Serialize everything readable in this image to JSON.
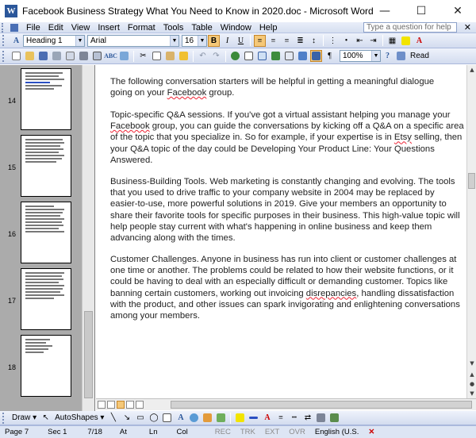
{
  "window": {
    "title": "Facebook Business Strategy What You Need to Know in 2020.doc - Microsoft Word",
    "minimize": "—",
    "maximize": "☐",
    "close": "✕"
  },
  "menu": {
    "items": [
      "File",
      "Edit",
      "View",
      "Insert",
      "Format",
      "Tools",
      "Table",
      "Window",
      "Help"
    ],
    "question_placeholder": "Type a question for help",
    "close_glyph": "✕"
  },
  "format_toolbar": {
    "style": "Heading 1",
    "font": "Arial",
    "size": "16",
    "bold": "B",
    "italic": "I",
    "underline": "U"
  },
  "standard_toolbar": {
    "zoom": "100%",
    "read_label": "Read"
  },
  "thumbnails": [
    {
      "page": "14"
    },
    {
      "page": "15"
    },
    {
      "page": "16"
    },
    {
      "page": "17"
    },
    {
      "page": "18"
    }
  ],
  "document": {
    "paragraphs": [
      {
        "lines": [
          [
            {
              "t": "The following conversation starters will be helpful in getting a meaningful dialogue"
            }
          ],
          [
            {
              "t": "going on your "
            },
            {
              "t": "Facebook",
              "sq": true
            },
            {
              "t": " group."
            }
          ]
        ]
      },
      {
        "lines": [
          [
            {
              "t": "Topic-specific Q&A sessions. If you've got a virtual assistant helping you manage your"
            }
          ],
          [
            {
              "t": "Facebook",
              "sq": true
            },
            {
              "t": " group, you can guide the conversations by kicking off a Q&A on a specific area"
            }
          ],
          [
            {
              "t": "of the topic that you specialize in. So for example, if your expertise is in "
            },
            {
              "t": "Etsy",
              "sq": true
            },
            {
              "t": " selling, then"
            }
          ],
          [
            {
              "t": "your Q&A topic of the day could be Developing Your Product Line: Your Questions"
            }
          ],
          [
            {
              "t": "Answered."
            }
          ]
        ]
      },
      {
        "lines": [
          [
            {
              "t": "Business-Building Tools. Web marketing is constantly changing and evolving. The tools"
            }
          ],
          [
            {
              "t": "that you used to drive traffic to your company website in 2004 may be replaced by"
            }
          ],
          [
            {
              "t": "easier-to-use, more powerful solutions in 2019. Give your members an opportunity to"
            }
          ],
          [
            {
              "t": "share their favorite tools for specific purposes in their business. This high-value topic will"
            }
          ],
          [
            {
              "t": "help people stay current with what's happening in online business and keep them"
            }
          ],
          [
            {
              "t": "advancing along with the times."
            }
          ]
        ]
      },
      {
        "lines": [
          [
            {
              "t": "Customer Challenges. Anyone in business has run into client or customer challenges at"
            }
          ],
          [
            {
              "t": "one time or another. The problems could be related to how their website functions, or it"
            }
          ],
          [
            {
              "t": "could be having to deal with an especially difficult or demanding customer. Topics like"
            }
          ],
          [
            {
              "t": "banning certain customers, working out invoicing "
            },
            {
              "t": "disrepancies",
              "sq": true
            },
            {
              "t": ", handling dissatisfaction"
            }
          ],
          [
            {
              "t": "with the product, and other issues can spark invigorating and enlightening conversations"
            }
          ],
          [
            {
              "t": "among your members."
            }
          ]
        ]
      }
    ]
  },
  "drawing_toolbar": {
    "draw": "Draw ▾",
    "autoshapes": "AutoShapes ▾"
  },
  "status": {
    "page": "Page 7",
    "section": "Sec 1",
    "count": "7/18",
    "at": "At",
    "ln": "Ln",
    "col": "Col",
    "rec": "REC",
    "trk": "TRK",
    "ext": "EXT",
    "ovr": "OVR",
    "language": "English (U.S."
  }
}
